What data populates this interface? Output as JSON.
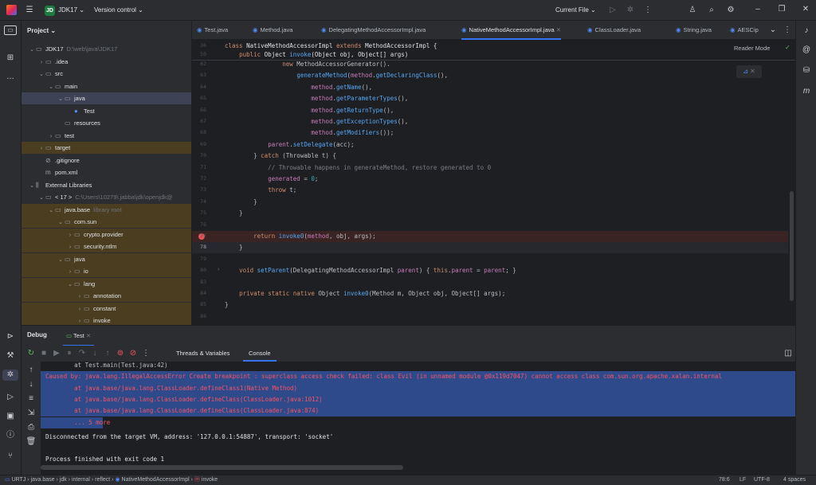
{
  "titlebar": {
    "project_badge": "JD",
    "project_name": "JDK17",
    "vcs": "Version control",
    "run_config": "Current File"
  },
  "project_panel": {
    "title": "Project",
    "tree": [
      {
        "label": "JDK17",
        "extra": "D:\\web\\java\\JDK17",
        "indent": 0,
        "arrow": "v",
        "icon": "folder"
      },
      {
        "label": ".idea",
        "extra": "",
        "indent": 1,
        "arrow": ">",
        "icon": "folder"
      },
      {
        "label": "src",
        "extra": "",
        "indent": 1,
        "arrow": "v",
        "icon": "folder"
      },
      {
        "label": "main",
        "extra": "",
        "indent": 2,
        "arrow": "v",
        "icon": "folder"
      },
      {
        "label": "java",
        "extra": "",
        "indent": 3,
        "arrow": "v",
        "icon": "folder"
      },
      {
        "label": "Test",
        "extra": "",
        "indent": 4,
        "arrow": "",
        "icon": "class"
      },
      {
        "label": "resources",
        "extra": "",
        "indent": 3,
        "arrow": "",
        "icon": "folder"
      },
      {
        "label": "test",
        "extra": "",
        "indent": 2,
        "arrow": ">",
        "icon": "folder"
      },
      {
        "label": "target",
        "extra": "",
        "indent": 1,
        "arrow": ">",
        "icon": "folder"
      },
      {
        "label": ".gitignore",
        "extra": "",
        "indent": 1,
        "arrow": "",
        "icon": "file"
      },
      {
        "label": "pom.xml",
        "extra": "",
        "indent": 1,
        "arrow": "",
        "icon": "maven"
      },
      {
        "label": "External Libraries",
        "extra": "",
        "indent": 0,
        "arrow": "v",
        "icon": "lib"
      },
      {
        "label": "< 17 >",
        "extra": "C:\\Users\\10279\\.jabba\\jdk\\openjdk@",
        "indent": 1,
        "arrow": "v",
        "icon": "folder"
      },
      {
        "label": "java.base",
        "extra": "library root",
        "indent": 2,
        "arrow": "v",
        "icon": "folder"
      },
      {
        "label": "com.sun",
        "extra": "",
        "indent": 3,
        "arrow": "v",
        "icon": "folder"
      },
      {
        "label": "crypto.provider",
        "extra": "",
        "indent": 4,
        "arrow": ">",
        "icon": "folder"
      },
      {
        "label": "security.ntlm",
        "extra": "",
        "indent": 4,
        "arrow": ">",
        "icon": "folder"
      },
      {
        "label": "java",
        "extra": "",
        "indent": 3,
        "arrow": "v",
        "icon": "folder"
      },
      {
        "label": "io",
        "extra": "",
        "indent": 4,
        "arrow": ">",
        "icon": "folder"
      },
      {
        "label": "lang",
        "extra": "",
        "indent": 4,
        "arrow": "v",
        "icon": "folder"
      },
      {
        "label": "annotation",
        "extra": "",
        "indent": 5,
        "arrow": ">",
        "icon": "folder"
      },
      {
        "label": "constant",
        "extra": "",
        "indent": 5,
        "arrow": ">",
        "icon": "folder"
      },
      {
        "label": "invoke",
        "extra": "",
        "indent": 5,
        "arrow": ">",
        "icon": "folder"
      }
    ]
  },
  "tabs": [
    {
      "label": "Test.java",
      "active": false
    },
    {
      "label": "Method.java",
      "active": false
    },
    {
      "label": "DelegatingMethodAccessorImpl.java",
      "active": false
    },
    {
      "label": "NativeMethodAccessorImpl.java",
      "active": true
    },
    {
      "label": "ClassLoader.java",
      "active": false
    },
    {
      "label": "String.java",
      "active": false
    },
    {
      "label": "AESCip",
      "active": false
    }
  ],
  "editor": {
    "reader_mode": "Reader Mode",
    "sticky": [
      {
        "n": "36",
        "t": "class NativeMethodAccessorImpl extends MethodAccessorImpl {"
      },
      {
        "n": "50",
        "t": "    public Object invoke(Object obj, Object[] args)"
      }
    ],
    "lines": [
      {
        "n": "62",
        "t": "                new MethodAccessorGenerator()."
      },
      {
        "n": "63",
        "t": "                    generateMethod(method.getDeclaringClass(),"
      },
      {
        "n": "64",
        "t": "                        method.getName(),"
      },
      {
        "n": "65",
        "t": "                        method.getParameterTypes(),"
      },
      {
        "n": "66",
        "t": "                        method.getReturnType(),"
      },
      {
        "n": "67",
        "t": "                        method.getExceptionTypes(),"
      },
      {
        "n": "68",
        "t": "                        method.getModifiers());"
      },
      {
        "n": "69",
        "t": "            parent.setDelegate(acc);"
      },
      {
        "n": "70",
        "t": "        } catch (Throwable t) {"
      },
      {
        "n": "71",
        "t": "            // Throwable happens in generateMethod, restore generated to 0"
      },
      {
        "n": "72",
        "t": "            generated = 0;"
      },
      {
        "n": "73",
        "t": "            throw t;"
      },
      {
        "n": "74",
        "t": "        }"
      },
      {
        "n": "75",
        "t": "    }"
      },
      {
        "n": "76",
        "t": ""
      },
      {
        "n": "77",
        "t": "        return invoke0(method, obj, args);"
      },
      {
        "n": "78",
        "t": "    }"
      },
      {
        "n": "79",
        "t": ""
      },
      {
        "n": "80",
        "t": "    void setParent(DelegatingMethodAccessorImpl parent) { this.parent = parent; }"
      },
      {
        "n": "83",
        "t": ""
      },
      {
        "n": "84",
        "t": "    private static native Object invoke0(Method m, Object obj, Object[] args);"
      },
      {
        "n": "85",
        "t": "}"
      },
      {
        "n": "86",
        "t": ""
      }
    ]
  },
  "debug": {
    "title": "Debug",
    "session_tab": "Test",
    "threads_tab": "Threads & Variables",
    "console_tab": "Console"
  },
  "console": {
    "lines": [
      {
        "t": "        at Test.main(Test.java:42)",
        "kind": "link",
        "sel": false
      },
      {
        "t": "Caused by: java.lang.IllegalAccessError Create breakpoint : superclass access check failed: class Evil (in unnamed module @0x119d7047) cannot access class com.sun.org.apache.xalan.internal",
        "kind": "err",
        "sel": true
      },
      {
        "t": "        at java.base/java.lang.ClassLoader.defineClass1(Native Method)",
        "kind": "err",
        "sel": true
      },
      {
        "t": "        at java.base/java.lang.ClassLoader.defineClass(ClassLoader.java:1012)",
        "kind": "err",
        "sel": true
      },
      {
        "t": "        at java.base/java.lang.ClassLoader.defineClass(ClassLoader.java:874)",
        "kind": "err",
        "sel": true
      },
      {
        "t": "        ... 5 more",
        "kind": "err",
        "sel": true
      },
      {
        "t": "Disconnected from the target VM, address: '127.0.0.1:54887', transport: 'socket'",
        "kind": "plain",
        "sel": false
      },
      {
        "t": "",
        "kind": "plain",
        "sel": false
      },
      {
        "t": "Process finished with exit code 1",
        "kind": "plain",
        "sel": false
      }
    ]
  },
  "status": {
    "breadcrumbs": [
      "URTJ",
      "java.base",
      "jdk",
      "internal",
      "reflect",
      "NativeMethodAccessorImpl",
      "invoke"
    ],
    "position": "78:6",
    "line_sep": "LF",
    "encoding": "UTF-8",
    "indent": "4 spaces"
  }
}
